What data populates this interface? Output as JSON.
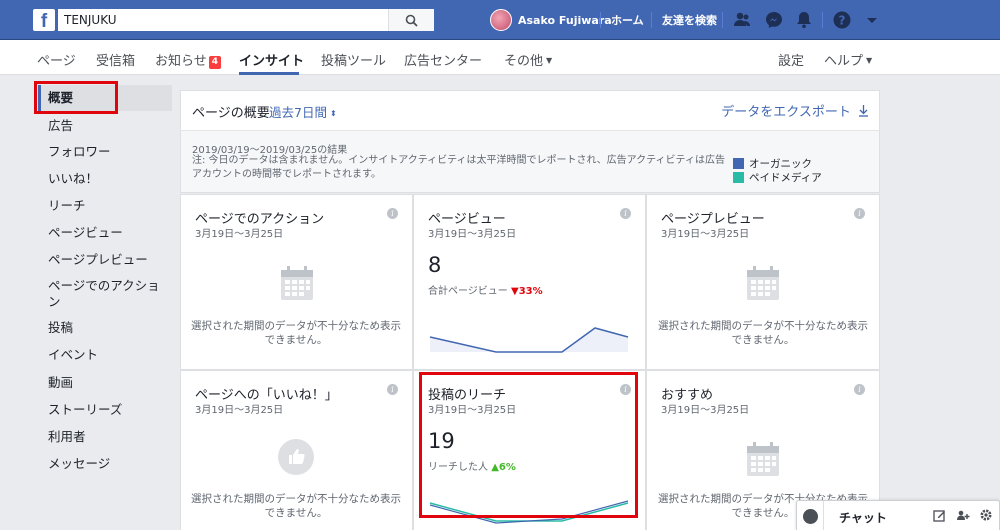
{
  "topbar": {
    "logo": "f",
    "search_value": "TENJUKU",
    "user_name": "Asako Fujiwara",
    "home_label": "ホーム",
    "find_friends_label": "友達を検索"
  },
  "pagenav": {
    "items": [
      {
        "label": "ページ"
      },
      {
        "label": "受信箱"
      },
      {
        "label": "お知らせ",
        "badge": "4"
      },
      {
        "label": "インサイト"
      },
      {
        "label": "投稿ツール"
      },
      {
        "label": "広告センター"
      },
      {
        "label": "その他"
      }
    ],
    "settings_label": "設定",
    "help_label": "ヘルプ"
  },
  "sidebar": {
    "items": [
      {
        "label": "概要"
      },
      {
        "label": "広告"
      },
      {
        "label": "フォロワー"
      },
      {
        "label": "いいね！"
      },
      {
        "label": "リーチ"
      },
      {
        "label": "ページビュー"
      },
      {
        "label": "ページプレビュー"
      },
      {
        "label": "ページでのアクション"
      },
      {
        "label": "投稿"
      },
      {
        "label": "イベント"
      },
      {
        "label": "動画"
      },
      {
        "label": "ストーリーズ"
      },
      {
        "label": "利用者"
      },
      {
        "label": "メッセージ"
      }
    ]
  },
  "overview": {
    "title": "ページの概要",
    "range_label": "過去7日間",
    "export_label": "データをエクスポート",
    "result_date": "2019/03/19～2019/03/25の結果",
    "note": "注: 今日のデータは含まれません。インサイトアクティビティは太平洋時間でレポートされ、広告アクティビティは広告アカウントの時間帯でレポートされます。",
    "legend": [
      {
        "label": "オーガニック",
        "color": "#4267b2"
      },
      {
        "label": "ペイドメディア",
        "color": "#2abba7"
      }
    ]
  },
  "cards": {
    "nodata_text": "選択された期間のデータが不十分なため表示できません。",
    "items": [
      {
        "title": "ページでのアクション",
        "date": "3月19日～3月25日"
      },
      {
        "title": "ページビュー",
        "date": "3月19日～3月25日",
        "value": "8",
        "metric_label": "合計ページビュー",
        "change": "▼33%"
      },
      {
        "title": "ページプレビュー",
        "date": "3月19日～3月25日"
      },
      {
        "title": "ページへの「いいね！」",
        "date": "3月19日～3月25日"
      },
      {
        "title": "投稿のリーチ",
        "date": "3月19日～3月25日",
        "value": "19",
        "metric_label": "リーチした人",
        "change": "▲6%"
      },
      {
        "title": "おすすめ",
        "date": "3月19日～3月25日"
      }
    ]
  },
  "chat": {
    "label": "チャット"
  }
}
